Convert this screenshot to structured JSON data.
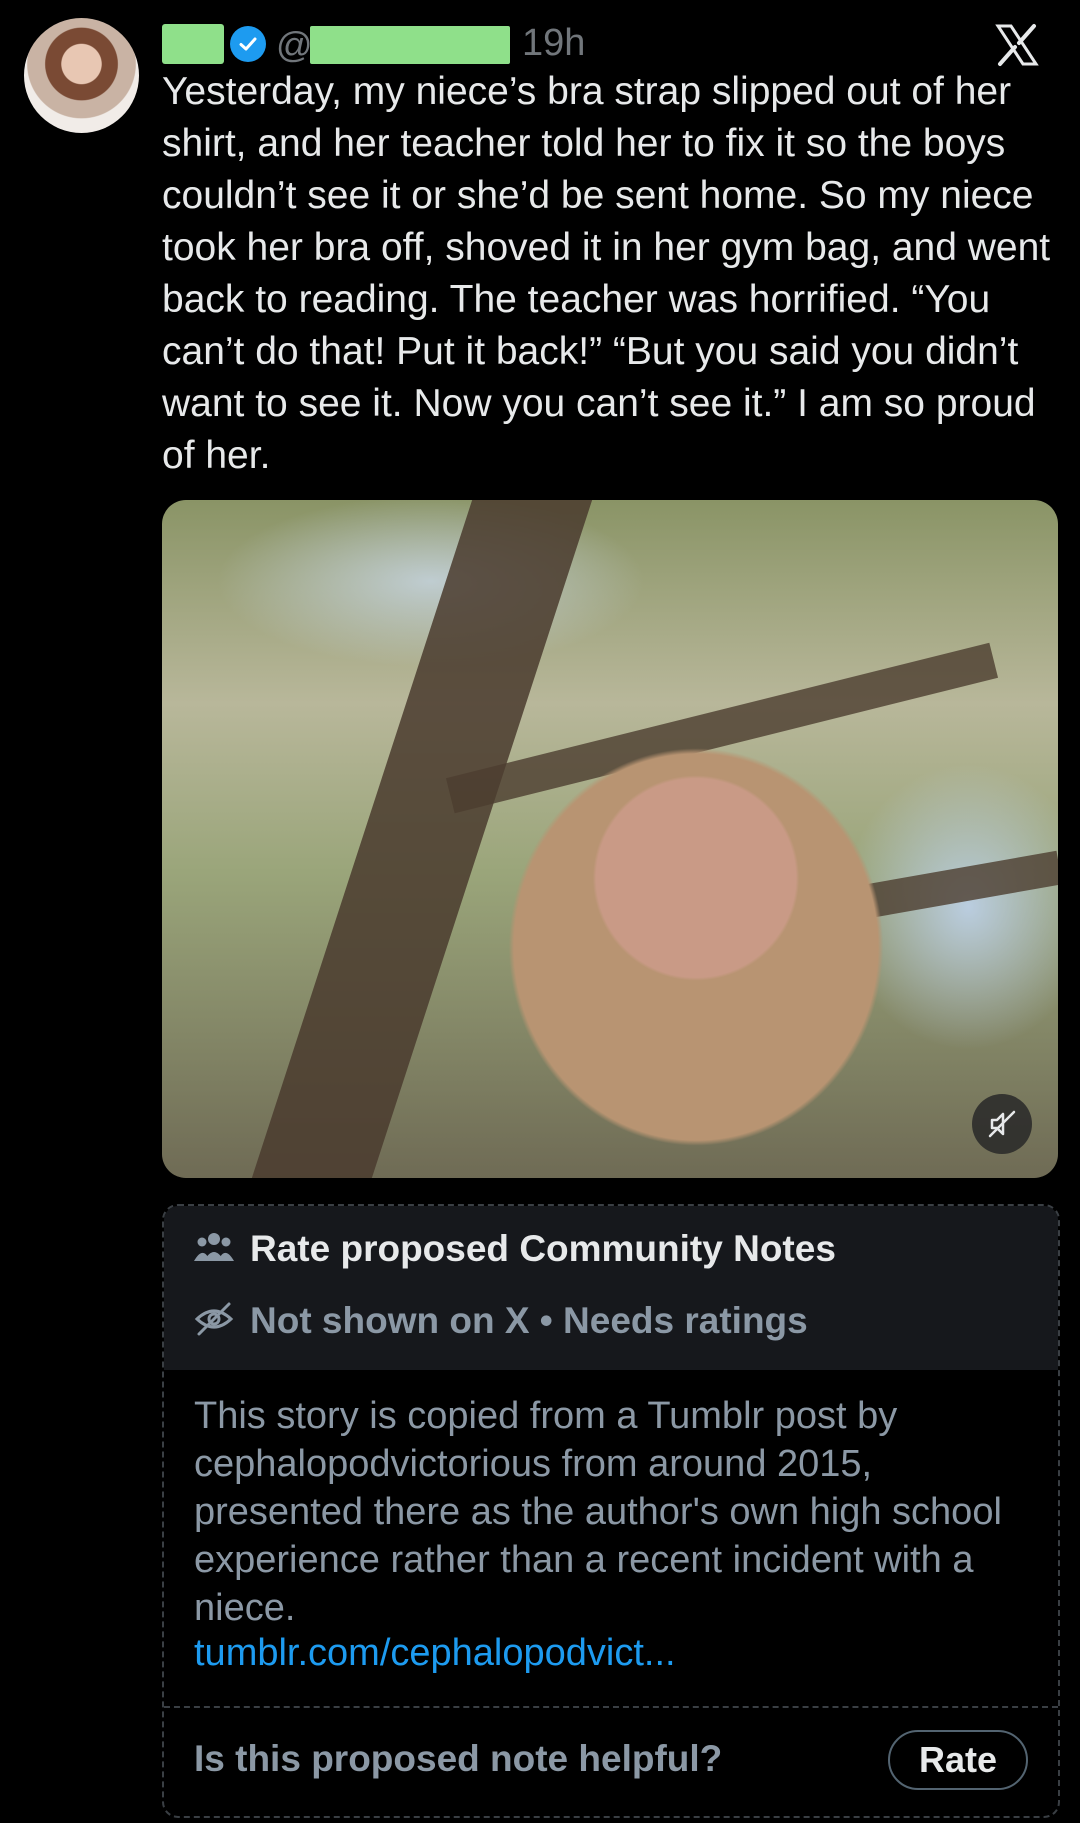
{
  "post": {
    "handle_prefix": "@",
    "time": "19h",
    "text": "Yesterday, my niece’s bra strap slipped out of her shirt, and her teacher told her to fix it so the boys couldn’t see it or she’d be sent home. So my niece took her bra off, shoved it in her gym bag, and went back to reading. The teacher was horrified. “You can’t do that! Put it back!” “But you said you didn’t want to see it. Now you can’t see it.” I am so proud of her."
  },
  "icons": {
    "verified": "verified-badge-icon",
    "brand": "x-logo-icon",
    "mute": "speaker-muted-icon",
    "people": "people-icon",
    "hidden": "eye-slash-icon"
  },
  "community_note": {
    "title": "Rate proposed Community Notes",
    "status": "Not shown on X • Needs ratings",
    "body": "This story is copied from a Tumblr post by cephalopodvictorious from around 2015, presented there as the author's own high school experience rather than a recent incident with a niece.",
    "link": "tumblr.com/cephalopodvict...",
    "prompt": "Is this proposed note helpful?",
    "rate_label": "Rate"
  },
  "colors": {
    "background": "#000000",
    "text": "#e7e9ea",
    "muted": "#71767b",
    "accent": "#1d9bf0",
    "redaction": "#8fe08a"
  }
}
